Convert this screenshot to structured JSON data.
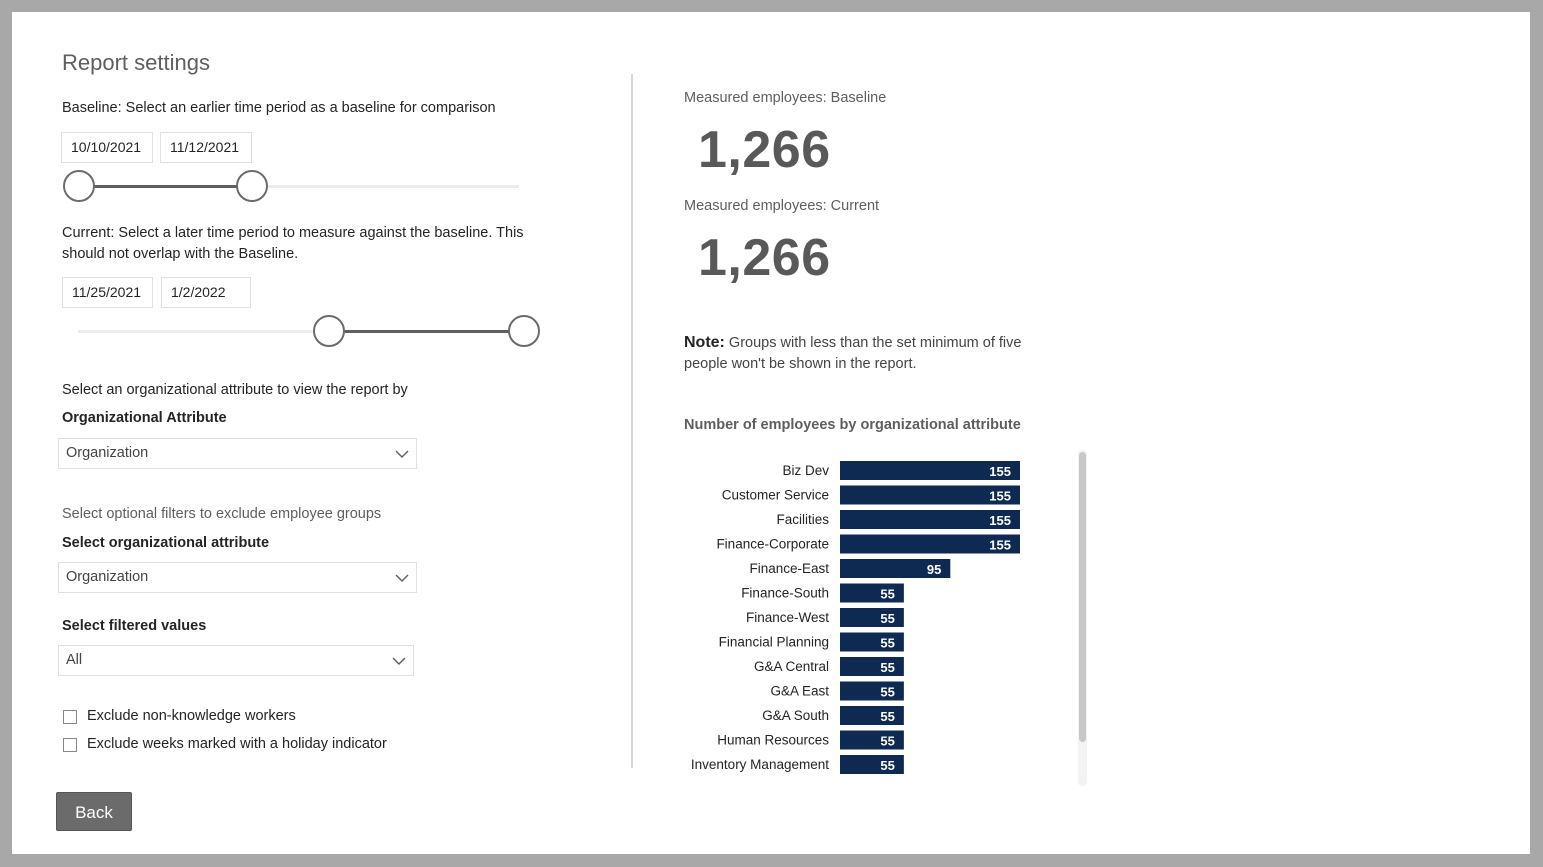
{
  "title": "Report settings",
  "baseline": {
    "description": "Baseline: Select an earlier time period as a baseline for comparison",
    "start_date": "10/10/2021",
    "end_date": "11/12/2021"
  },
  "current": {
    "description_line1": "Current: Select a later time period to measure against the baseline. This",
    "description_line2": "should not overlap with the Baseline.",
    "start_date": "11/25/2021",
    "end_date": "1/2/2022"
  },
  "org_attribute": {
    "prompt": "Select an organizational attribute to view the report by",
    "label": "Organizational Attribute",
    "value": "Organization"
  },
  "filters": {
    "prompt": "Select optional filters to exclude employee groups",
    "attribute_label": "Select organizational attribute",
    "attribute_value": "Organization",
    "values_label": "Select filtered values",
    "values_value": "All"
  },
  "checkboxes": {
    "exclude_non_knowledge": "Exclude non-knowledge workers",
    "exclude_holiday": "Exclude weeks marked with a holiday indicator"
  },
  "back_button": "Back",
  "kpis": {
    "baseline_label": "Measured employees: Baseline",
    "baseline_value": "1,266",
    "current_label": "Measured employees: Current",
    "current_value": "1,266"
  },
  "note": {
    "label": "Note:",
    "text": " Groups with less than the set minimum of five people won't be shown in the report."
  },
  "colors": {
    "bar": "#0e2a52",
    "slider_selected": "#5f5f5f"
  },
  "chart_data": {
    "type": "bar",
    "orientation": "horizontal",
    "title": "Number of employees by organizational attribute",
    "categories": [
      "Biz Dev",
      "Customer Service",
      "Facilities",
      "Finance-Corporate",
      "Finance-East",
      "Finance-South",
      "Finance-West",
      "Financial Planning",
      "G&A Central",
      "G&A East",
      "G&A South",
      "Human Resources",
      "Inventory Management"
    ],
    "values": [
      155,
      155,
      155,
      155,
      95,
      55,
      55,
      55,
      55,
      55,
      55,
      55,
      55
    ],
    "data_labels": true,
    "grid": false
  }
}
